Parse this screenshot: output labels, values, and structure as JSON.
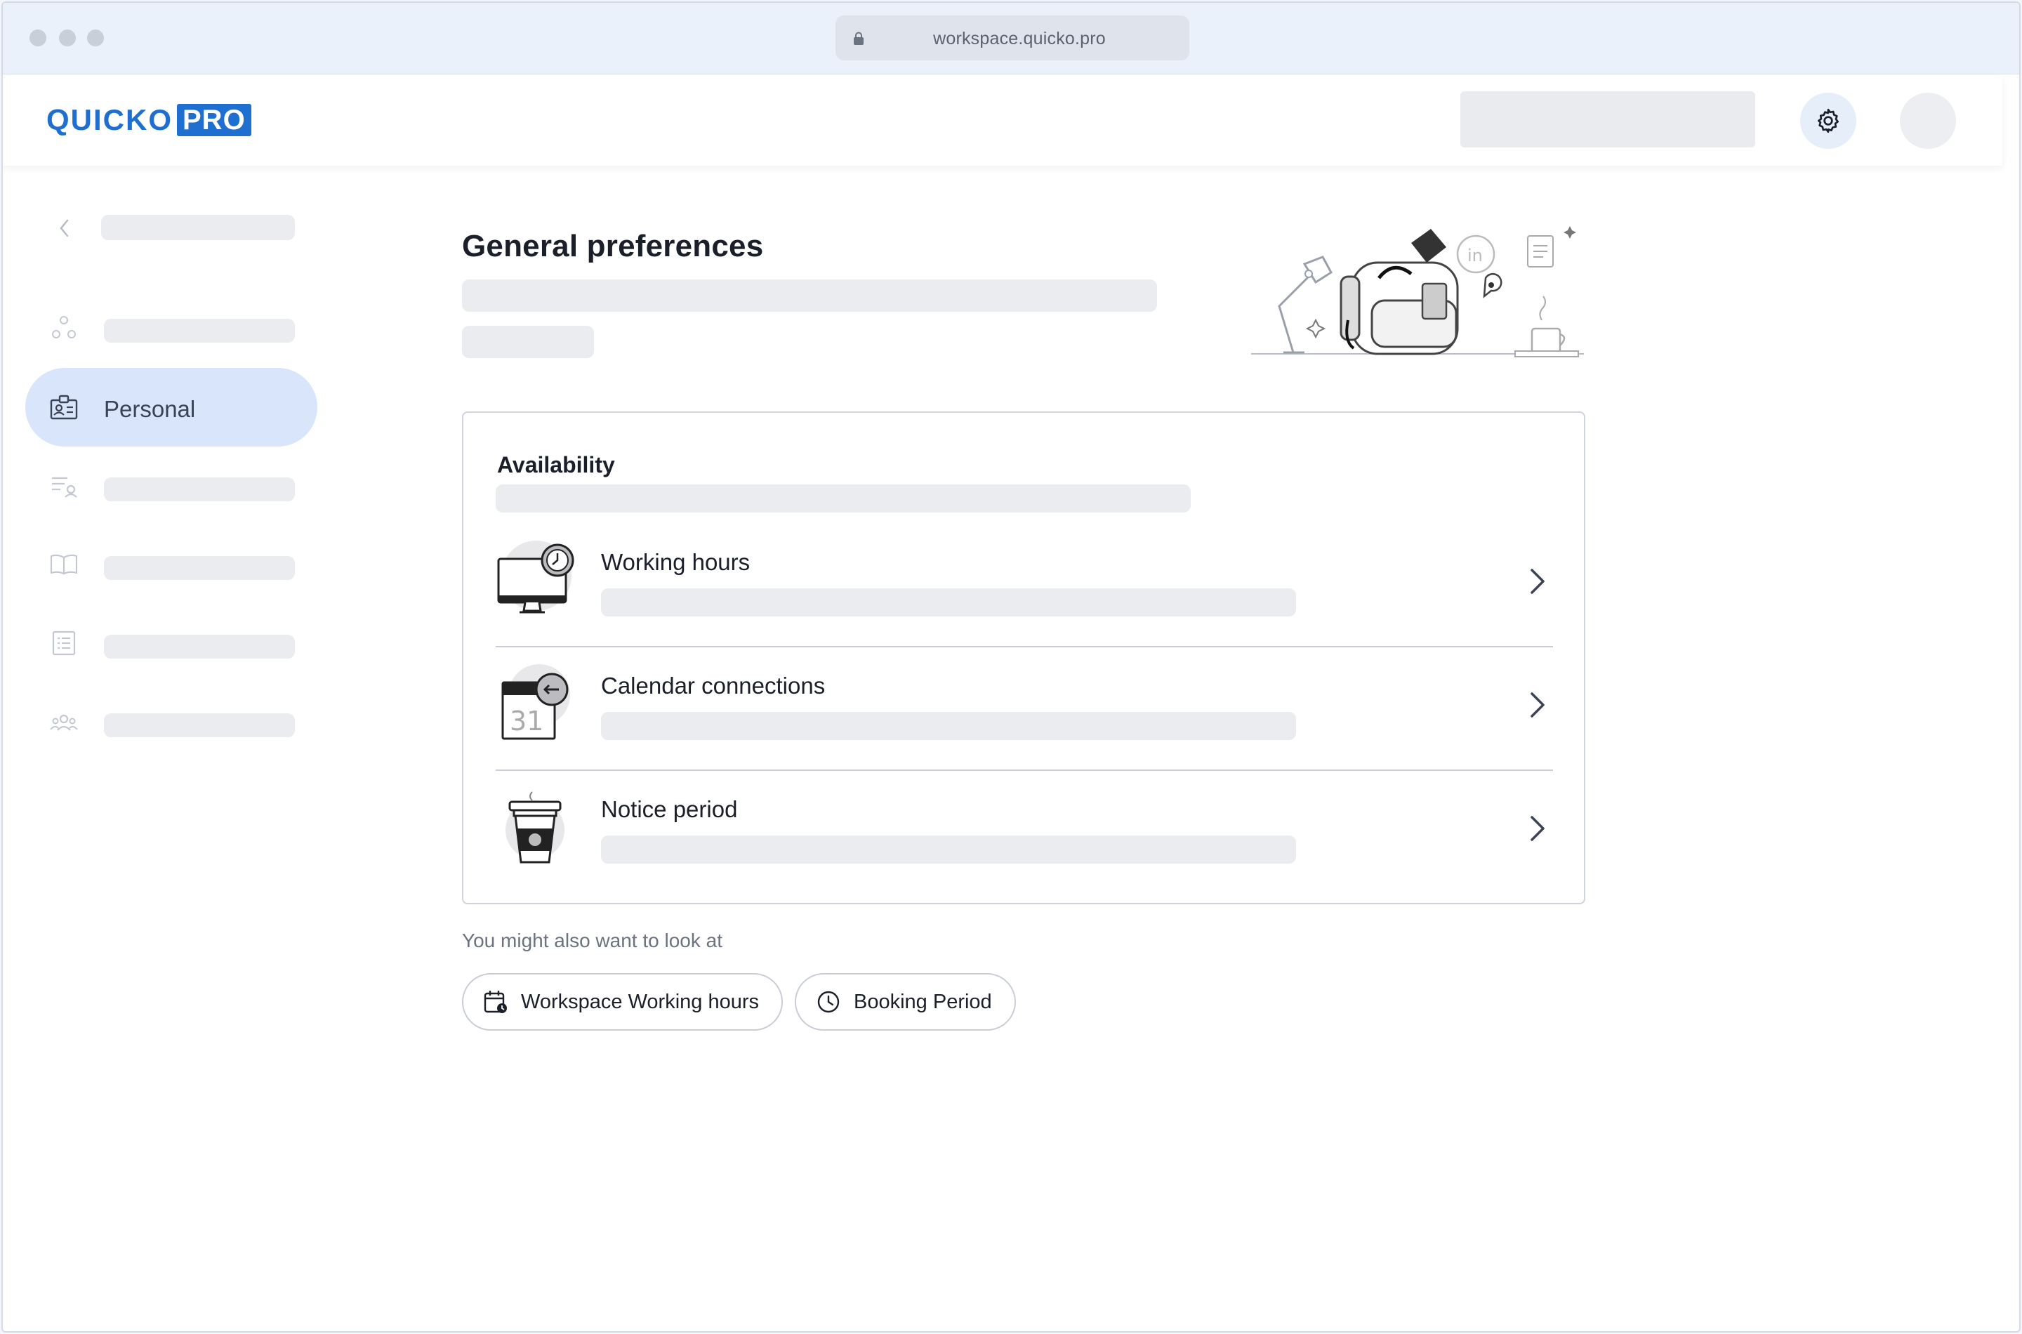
{
  "browser": {
    "url": "workspace.quicko.pro"
  },
  "brand": {
    "name_part": "QUICKO",
    "badge": "PRO",
    "color": "#1f6fd1"
  },
  "sidebar": {
    "active_item": {
      "label": "Personal",
      "icon": "id-card-icon",
      "highlight": "#d8e5fb"
    },
    "placeholder_icons": [
      "nodes-icon",
      "filter-list-icon",
      "book-icon",
      "list-icon",
      "team-icon"
    ]
  },
  "page": {
    "title": "General preferences"
  },
  "availability": {
    "title": "Availability",
    "items": [
      {
        "label": "Working hours",
        "icon": "monitor-clock-icon"
      },
      {
        "label": "Calendar connections",
        "icon": "calendar-sync-icon"
      },
      {
        "label": "Notice period",
        "icon": "coffee-cup-icon"
      }
    ]
  },
  "suggestions": {
    "hint": "You might also want to look at",
    "chips": [
      {
        "label": "Workspace Working hours",
        "icon": "calendar-clock-icon"
      },
      {
        "label": "Booking Period",
        "icon": "clock-icon"
      }
    ]
  }
}
